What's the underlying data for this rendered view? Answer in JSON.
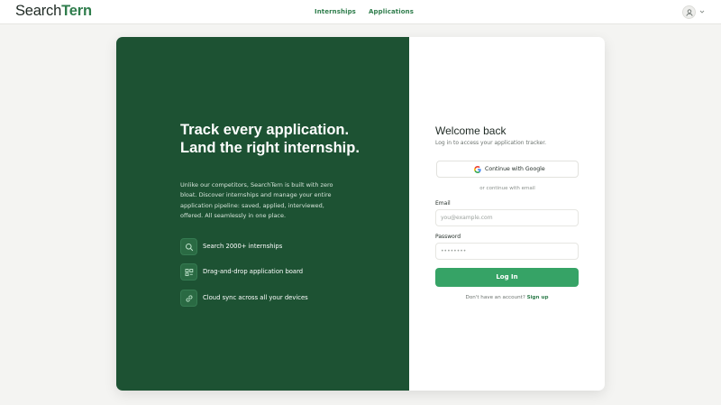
{
  "brand": {
    "part1": "Search",
    "part2": "Tern"
  },
  "nav": {
    "internships": "Internships",
    "applications": "Applications"
  },
  "user": {
    "avatar_icon": "user-icon",
    "menu_icon": "chevron-down-icon"
  },
  "hero": {
    "title": "Track every application. Land the right internship.",
    "description": "Unlike our competitors, SearchTern is built with zero bloat. Discover internships and manage your entire application pipeline: saved, applied, interviewed, offered. All seamlessly in one place.",
    "features": [
      {
        "icon": "search-icon",
        "label": "Search 2000+ internships"
      },
      {
        "icon": "board-icon",
        "label": "Drag-and-drop application board"
      },
      {
        "icon": "link-icon",
        "label": "Cloud sync across all your devices"
      }
    ]
  },
  "form": {
    "title": "Welcome back",
    "subtitle": "Log in to access your application tracker.",
    "google_label": "Continue with Google",
    "divider": "or continue with email",
    "email_label": "Email",
    "email_placeholder": "you@example.com",
    "password_label": "Password",
    "password_placeholder": "••••••••",
    "login_label": "Log In",
    "signup_prompt": "Don't have an account?",
    "signup_link": "Sign up"
  },
  "colors": {
    "accent": "#2f7d4c",
    "hero_bg": "#1d5233",
    "button": "#36a366",
    "page_bg": "#f4f4f2"
  }
}
